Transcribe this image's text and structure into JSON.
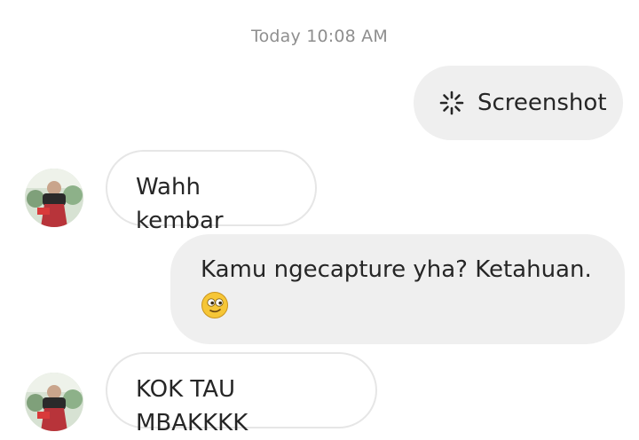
{
  "thread": {
    "timestamp": "Today 10:08 AM"
  },
  "messages": [
    {
      "direction": "sent",
      "type": "attachment",
      "icon": "loading-spinner-icon",
      "text": "Screenshot"
    },
    {
      "direction": "received",
      "type": "text",
      "text": "Wahh kembar"
    },
    {
      "direction": "sent",
      "type": "text",
      "text": "Kamu ngecapture yha? Ketahuan.",
      "emoji": "smirk-face-emoji"
    },
    {
      "direction": "received",
      "type": "text",
      "text": "KOK TAU MBAKKKK"
    }
  ],
  "colors": {
    "sent_bubble": "#efefef",
    "received_border": "#e6e6e6",
    "timestamp": "#8e8e8e",
    "text": "#262626"
  }
}
